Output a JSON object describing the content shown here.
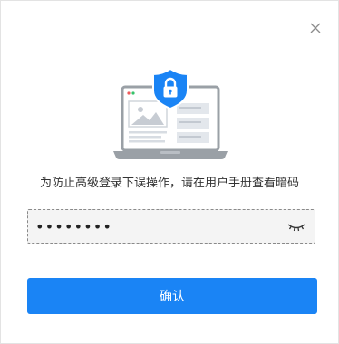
{
  "dialog": {
    "message": "为防止高级登录下误操作，请在用户手册查看暗码",
    "password": {
      "value": "●●●●●●●●",
      "type": "password",
      "toggle_icon": "eye-closed-icon"
    },
    "confirm_label": "确认",
    "close_icon": "close-icon",
    "illustration_icon": "laptop-shield-lock-icon"
  },
  "colors": {
    "accent": "#1a84f5",
    "laptop_frame": "#9aa0a6",
    "screen_detail": "#d7dce2"
  }
}
